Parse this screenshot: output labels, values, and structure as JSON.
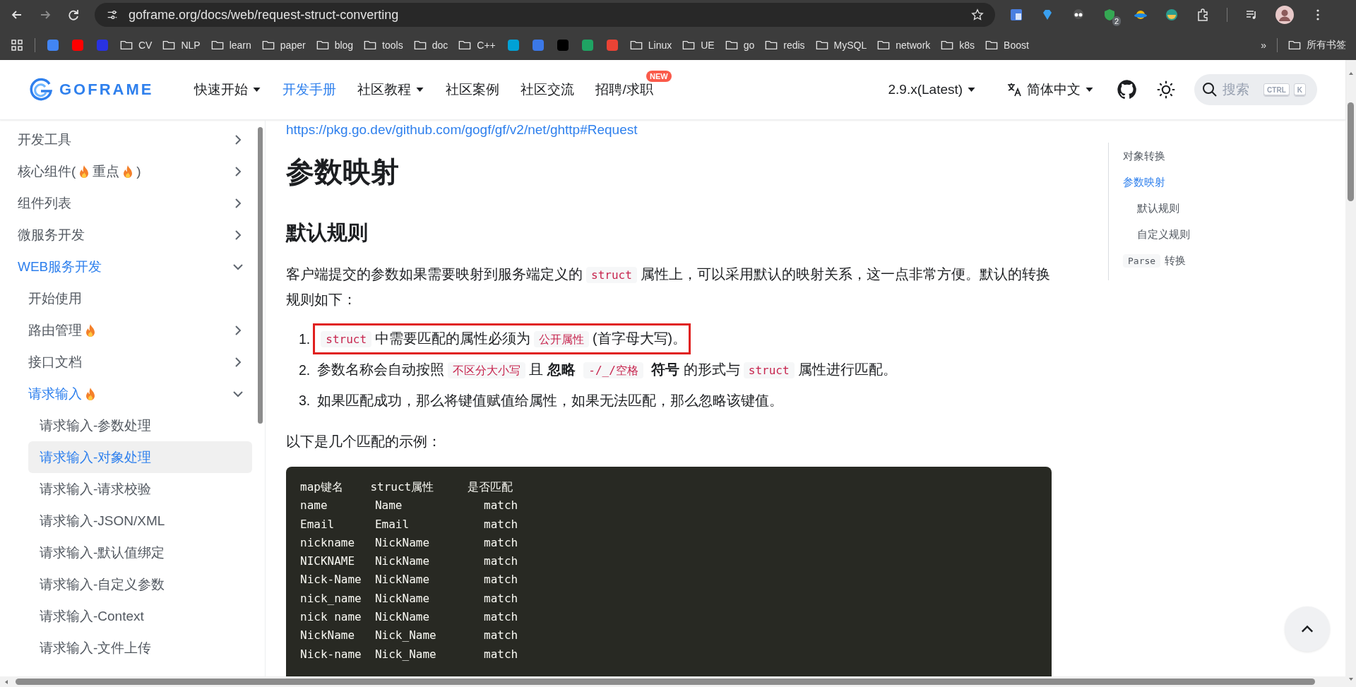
{
  "browser": {
    "url": "goframe.org/docs/web/request-struct-converting",
    "extension_badge": "2",
    "bookmarks": [
      {
        "kind": "site",
        "color": "#4285f4"
      },
      {
        "kind": "site",
        "color": "#ff0000"
      },
      {
        "kind": "site",
        "color": "#2932e1"
      },
      {
        "kind": "folder",
        "label": "CV"
      },
      {
        "kind": "folder",
        "label": "NLP"
      },
      {
        "kind": "folder",
        "label": "learn"
      },
      {
        "kind": "folder",
        "label": "paper"
      },
      {
        "kind": "folder",
        "label": "blog"
      },
      {
        "kind": "folder",
        "label": "tools"
      },
      {
        "kind": "folder",
        "label": "doc"
      },
      {
        "kind": "folder",
        "label": "C++"
      },
      {
        "kind": "site",
        "color": "#00a1d6"
      },
      {
        "kind": "site",
        "color": "#3b78e7"
      },
      {
        "kind": "site",
        "color": "#000000"
      },
      {
        "kind": "site",
        "color": "#1fa463"
      },
      {
        "kind": "site",
        "color": "#ea4335"
      },
      {
        "kind": "folder",
        "label": "Linux"
      },
      {
        "kind": "folder",
        "label": "UE"
      },
      {
        "kind": "folder",
        "label": "go"
      },
      {
        "kind": "folder",
        "label": "redis"
      },
      {
        "kind": "folder",
        "label": "MySQL"
      },
      {
        "kind": "folder",
        "label": "network"
      },
      {
        "kind": "folder",
        "label": "k8s"
      },
      {
        "kind": "folder",
        "label": "Boost"
      }
    ],
    "overflow": "»",
    "all_bookmarks": "所有书签"
  },
  "header": {
    "logo": "GOFRAME",
    "nav": [
      {
        "label": "快速开始",
        "dropdown": true,
        "selected": false
      },
      {
        "label": "开发手册",
        "dropdown": false,
        "selected": true
      },
      {
        "label": "社区教程",
        "dropdown": true,
        "selected": false
      },
      {
        "label": "社区案例",
        "dropdown": false,
        "selected": false
      },
      {
        "label": "社区交流",
        "dropdown": false,
        "selected": false
      },
      {
        "label": "招聘/求职",
        "dropdown": false,
        "selected": false,
        "badge": "NEW"
      }
    ],
    "version": "2.9.x(Latest)",
    "language": "简体中文",
    "search": {
      "placeholder": "搜索",
      "keys": [
        "CTRL",
        "K"
      ]
    }
  },
  "sidebar": {
    "items": [
      {
        "label": "开发工具",
        "expanded": false,
        "selected": false,
        "active": false
      },
      {
        "segments": [
          {
            "kind": "text",
            "text": "核心组件("
          },
          {
            "kind": "fire"
          },
          {
            "kind": "text",
            "text": "重点"
          },
          {
            "kind": "fire"
          },
          {
            "kind": "text",
            "text": ")"
          }
        ],
        "expanded": false,
        "selected": false,
        "active": false
      },
      {
        "label": "组件列表",
        "expanded": false,
        "selected": false,
        "active": false
      },
      {
        "label": "微服务开发",
        "expanded": false,
        "selected": false,
        "active": false
      },
      {
        "label": "WEB服务开发",
        "expanded": true,
        "selected": false,
        "active": true,
        "children": [
          {
            "label": "开始使用",
            "selected": false,
            "active": false
          },
          {
            "label": "路由管理",
            "hot": true,
            "expanded": false,
            "selected": false,
            "active": false
          },
          {
            "label": "接口文档",
            "expanded": false,
            "selected": false,
            "active": false
          },
          {
            "label": "请求输入",
            "hot": true,
            "expanded": true,
            "selected": false,
            "active": true,
            "children": [
              {
                "label": "请求输入-参数处理",
                "selected": false,
                "active": false
              },
              {
                "label": "请求输入-对象处理",
                "selected": true,
                "active": true
              },
              {
                "label": "请求输入-请求校验",
                "selected": false,
                "active": false
              },
              {
                "label": "请求输入-JSON/XML",
                "selected": false,
                "active": false
              },
              {
                "label": "请求输入-默认值绑定",
                "selected": false,
                "active": false
              },
              {
                "label": "请求输入-自定义参数",
                "selected": false,
                "active": false
              },
              {
                "label": "请求输入-Context",
                "selected": false,
                "active": false
              },
              {
                "label": "请求输入-文件上传",
                "selected": false,
                "active": false
              }
            ]
          }
        ]
      }
    ]
  },
  "article": {
    "link": "https://pkg.go.dev/github.com/gogf/gf/v2/net/ghttp#Request",
    "title": "参数映射",
    "subtitle": "默认规则",
    "intro": [
      {
        "kind": "text",
        "text": "客户端提交的参数如果需要映射到服务端定义的"
      },
      {
        "kind": "code",
        "text": "struct"
      },
      {
        "kind": "text",
        "text": "属性上，可以采用默认的映射关系，这一点非常方便。默认的转换规则如下："
      }
    ],
    "rules": [
      {
        "number": "1.",
        "highlighted": true,
        "segments": [
          {
            "kind": "code",
            "text": "struct"
          },
          {
            "kind": "text",
            "text": "中需要匹配的属性必须为"
          },
          {
            "kind": "code",
            "text": "公开属性"
          },
          {
            "kind": "text",
            "text": "(首字母大写)。"
          }
        ]
      },
      {
        "number": "2.",
        "highlighted": false,
        "segments": [
          {
            "kind": "text",
            "text": "参数名称会自动按照"
          },
          {
            "kind": "code",
            "text": "不区分大小写"
          },
          {
            "kind": "text",
            "text": "且"
          },
          {
            "kind": "bold",
            "text": "忽略"
          },
          {
            "kind": "code",
            "text": "-/_/空格"
          },
          {
            "kind": "bold",
            "text": "符号"
          },
          {
            "kind": "text",
            "text": "的形式与"
          },
          {
            "kind": "code",
            "text": "struct"
          },
          {
            "kind": "text",
            "text": "属性进行匹配。"
          }
        ]
      },
      {
        "number": "3.",
        "highlighted": false,
        "segments": [
          {
            "kind": "text",
            "text": "如果匹配成功，那么将键值赋值给属性，如果无法匹配，那么忽略该键值。"
          }
        ]
      }
    ],
    "examples_intro": "以下是几个匹配的示例：",
    "code": [
      "map键名    struct属性     是否匹配",
      "name       Name            match",
      "Email      Email           match",
      "nickname   NickName        match",
      "NICKNAME   NickName        match",
      "Nick-Name  NickName        match",
      "nick_name  NickName        match",
      "nick name  NickName        match",
      "NickName   Nick_Name       match",
      "Nick-name  Nick_Name       match"
    ]
  },
  "toc": [
    {
      "label": "对象转换",
      "selected": false
    },
    {
      "label": "参数映射",
      "selected": true,
      "children": [
        {
          "label": "默认规则",
          "selected": false
        },
        {
          "label": "自定义规则",
          "selected": false
        }
      ]
    },
    {
      "code": "Parse",
      "label": "转换",
      "selected": false
    }
  ]
}
